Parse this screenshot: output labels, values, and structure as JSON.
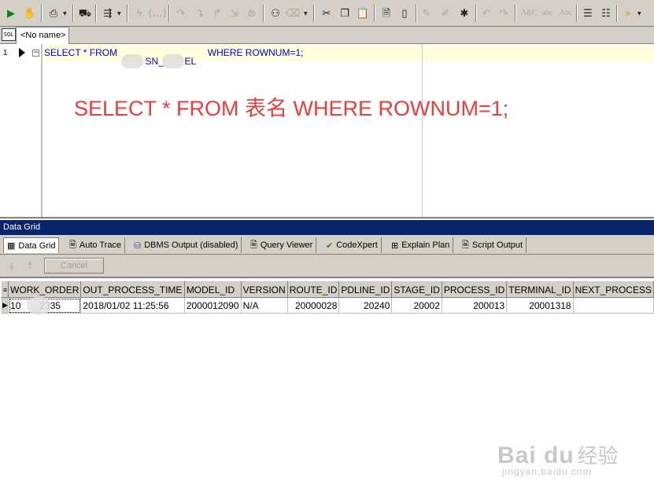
{
  "toolbar": {
    "case_labels": [
      "ABC",
      "abc",
      "Abc"
    ]
  },
  "editor": {
    "tab_label": "<No name>",
    "sql_icon_label": "SQL",
    "line_number": "1",
    "sql_before": "SELECT * FROM ",
    "sql_table_fragment_1": "SN_",
    "sql_table_fragment_2": "EL",
    "sql_after": " WHERE ROWNUM=1",
    "sql_end": ";",
    "annotation": "SELECT * FROM 表名 WHERE ROWNUM=1;"
  },
  "data_grid": {
    "panel_title": "Data Grid",
    "tabs": [
      {
        "label": "Data Grid",
        "icon": "grid-icon",
        "active": true
      },
      {
        "label": "Auto Trace",
        "icon": "document-icon",
        "active": false
      },
      {
        "label": "DBMS Output (disabled)",
        "icon": "dbms-icon",
        "active": false
      },
      {
        "label": "Query Viewer",
        "icon": "document-icon",
        "active": false
      },
      {
        "label": "CodeXpert",
        "icon": "codexpert-icon",
        "active": false
      },
      {
        "label": "Explain Plan",
        "icon": "explain-icon",
        "active": false
      },
      {
        "label": "Script Output",
        "icon": "document-icon",
        "active": false
      }
    ],
    "cancel_label": "Cancel",
    "columns": [
      "WORK_ORDER",
      "OUT_PROCESS_TIME",
      "MODEL_ID",
      "VERSION",
      "ROUTE_ID",
      "PDLINE_ID",
      "STAGE_ID",
      "PROCESS_ID",
      "TERMINAL_ID",
      "NEXT_PROCESS"
    ],
    "row": [
      "10",
      "2335",
      "2018/01/02 11:25:56",
      "2000012090",
      "N/A",
      "20000028",
      "20240",
      "20002",
      "200013",
      "20001318",
      ""
    ]
  },
  "watermark": {
    "logo": "Bai du",
    "cn": "经验",
    "url": "jingyan.baidu.com"
  }
}
